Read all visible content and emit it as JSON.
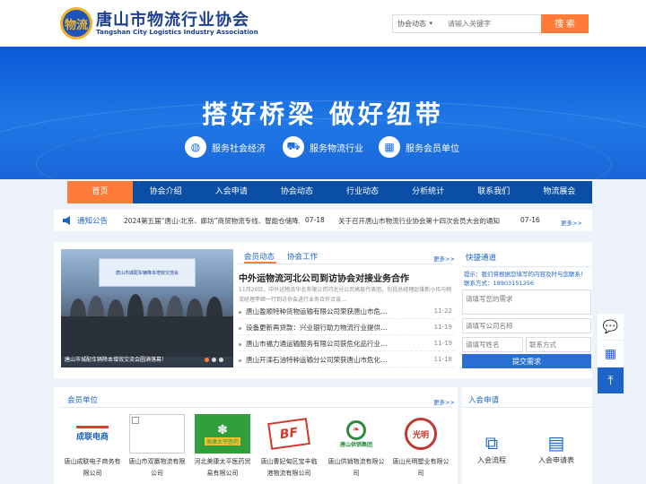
{
  "header": {
    "logo_mark": "物流",
    "title": "唐山市物流行业协会",
    "subtitle": "Tangshan City Logistics Industry Association",
    "search_scope": "协会动态",
    "search_placeholder": "请输入关键字",
    "search_button": "搜 索"
  },
  "hero": {
    "slogan": "搭好桥梁  做好纽带",
    "items": [
      {
        "label": "服务社会经济",
        "icon": "globe-icon",
        "glyph": "◍"
      },
      {
        "label": "服务物流行业",
        "icon": "truck-icon",
        "glyph": "⛟"
      },
      {
        "label": "服务会员单位",
        "icon": "building-icon",
        "glyph": "▦"
      }
    ]
  },
  "nav": [
    "首页",
    "协会介绍",
    "入会申请",
    "协会动态",
    "行业动态",
    "分析统计",
    "联系我们",
    "物流展会"
  ],
  "notice": {
    "label": "通知公告",
    "items": [
      {
        "text": "2024第五届“唐山-北京、廊坊”商贸物流专线、智能仓储降…",
        "date": "07-18"
      },
      {
        "text": "关于召开唐山市物流行业协会第十四次会员大会的通知",
        "date": "07-16"
      }
    ],
    "more": "更多>>"
  },
  "news": {
    "image_caption": "唐山市城配车辆降本增效交流会圆满落幕！",
    "banner_text": "唐山市城配车辆降本增效交流会",
    "tabs": [
      "会员动态",
      "协会工作"
    ],
    "more": "更多>>",
    "featured_title": "中外运物流河北公司到访协会对接业务合作",
    "featured_summary": "11月20日，中外运物流华北有限公司河北分公司高层代表团，包括总经理赵维新小伟与物流经理李继一行到访协会进行业务合作洽谈…",
    "list": [
      {
        "title": "唐山盈顺特种货物运输有限公司荣获唐山市危…",
        "date": "11-22"
      },
      {
        "title": "设备更新再贷款：兴业银行助力物流行业提供…",
        "date": "11-19"
      },
      {
        "title": "唐山市福力通运输服务有限公司获危化品行业…",
        "date": "11-19"
      },
      {
        "title": "唐山开滦石油特种运输分公司荣获唐山市危化…",
        "date": "11-18"
      }
    ]
  },
  "quick": {
    "title": "快捷通道",
    "notice_line1": "提示：我们将根据您填写的内容及时与您联系！",
    "notice_line2": "联系方式：18903151256",
    "request_placeholder": "请填写您的需求",
    "company_placeholder": "请填写公司名称",
    "name_placeholder": "请填写姓名",
    "contact_placeholder": "联系方式",
    "submit": "提交需求"
  },
  "members": {
    "title": "会员单位",
    "more": "更多>>",
    "items": [
      {
        "name": "唐山成联电子商务有限公司",
        "logo_text": "成联电商",
        "color": "#1a5fb4"
      },
      {
        "name": "唐山市双赢物流有限公司",
        "logo_text": "",
        "color": "#999999"
      },
      {
        "name": "河北美康太平医药贸易有限公司",
        "logo_text": "美康太平医药",
        "color": "#2f9e3b"
      },
      {
        "name": "唐山曹妃甸区宝丰临港物流有限公司",
        "logo_text": "BF",
        "color": "#d13a2a"
      },
      {
        "name": "唐山供销物流有限公司",
        "logo_text": "唐山供销集团",
        "color": "#2b8a3e"
      },
      {
        "name": "唐山光明塑业有限公司",
        "logo_text": "光明",
        "color": "#c0392b"
      }
    ]
  },
  "join": {
    "title": "入会申请",
    "items": [
      {
        "label": "入会流程",
        "icon": "flow-icon",
        "glyph": "⧉"
      },
      {
        "label": "入会申请表",
        "icon": "form-icon",
        "glyph": "▤"
      }
    ]
  },
  "float_bar": [
    {
      "icon": "chat-icon",
      "glyph": "💬"
    },
    {
      "icon": "qrcode-icon",
      "glyph": "▦"
    },
    {
      "icon": "back-to-top-icon",
      "glyph": "⤒"
    }
  ]
}
